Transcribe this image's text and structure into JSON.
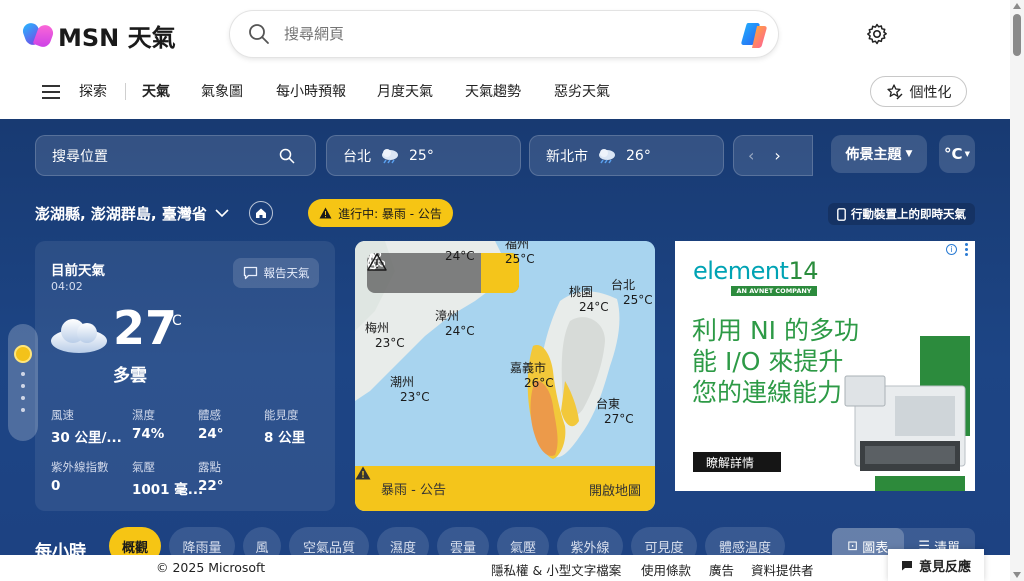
{
  "header": {
    "logo_text": "MSN 天氣",
    "search_placeholder": "搜尋網頁"
  },
  "nav": {
    "items": [
      "探索",
      "天氣",
      "氣象圖",
      "每小時預報",
      "月度天氣",
      "天氣趨勢",
      "惡劣天氣"
    ],
    "personalize_label": "個性化"
  },
  "toolbar": {
    "location_search_placeholder": "搜尋位置",
    "cities": [
      {
        "name": "台北",
        "temp": "25°"
      },
      {
        "name": "新北市",
        "temp": "26°"
      }
    ],
    "theme_label": "佈景主題",
    "unit_label": "°C"
  },
  "location": {
    "name": "澎湖縣, 澎湖群島, 臺灣省",
    "alert_label": "進行中: 暴雨 - 公告",
    "mobile_label": "行動裝置上的即時天氣"
  },
  "current": {
    "title": "目前天氣",
    "time": "04:02",
    "report_label": "報告天氣",
    "temperature": "27",
    "unit": "°C",
    "condition": "多雲",
    "metrics": [
      {
        "label": "風速",
        "value": "30 公里/..."
      },
      {
        "label": "濕度",
        "value": "74%"
      },
      {
        "label": "體感",
        "value": "24°"
      },
      {
        "label": "能見度",
        "value": "8 公里"
      },
      {
        "label": "紫外線指數",
        "value": "0"
      },
      {
        "label": "氣壓",
        "value": "1001 毫..."
      },
      {
        "label": "露點",
        "value": "22°"
      }
    ]
  },
  "map": {
    "labels": [
      {
        "name": "",
        "temp": "24°C"
      },
      {
        "name": "福州",
        "temp": "25°C"
      },
      {
        "name": "台北",
        "temp": "25°C"
      },
      {
        "name": "桃園",
        "temp": "24°C"
      },
      {
        "name": "梅州",
        "temp": "23°C"
      },
      {
        "name": "漳州",
        "temp": "24°C"
      },
      {
        "name": "嘉義市",
        "temp": "26°C"
      },
      {
        "name": "潮州",
        "temp": "23°C"
      },
      {
        "name": "台東",
        "temp": "27°C"
      }
    ],
    "alert_text": "暴雨 - 公告",
    "open_map_label": "開啟地圖"
  },
  "ad": {
    "brand": "element",
    "brand_suffix": "14",
    "tagline": "AN AVNET COMPANY",
    "headline": "利用 NI 的多功能 I/O 來提升您的連線能力",
    "cta": "瞭解詳情"
  },
  "hourly": {
    "title": "每小時",
    "tabs": [
      "概觀",
      "降雨量",
      "風",
      "空氣品質",
      "濕度",
      "雲量",
      "氣壓",
      "紫外線",
      "可見度",
      "體感溫度"
    ],
    "view_chart": "圖表",
    "view_list": "清單"
  },
  "footer": {
    "copyright": "© 2025 Microsoft",
    "links": [
      "隱私權 & 小型文字檔案",
      "使用條款",
      "廣告",
      "資料提供者"
    ],
    "feedback": "意見反應"
  },
  "colors": {
    "accent": "#f6c514",
    "background_blue": "#1d4585"
  }
}
